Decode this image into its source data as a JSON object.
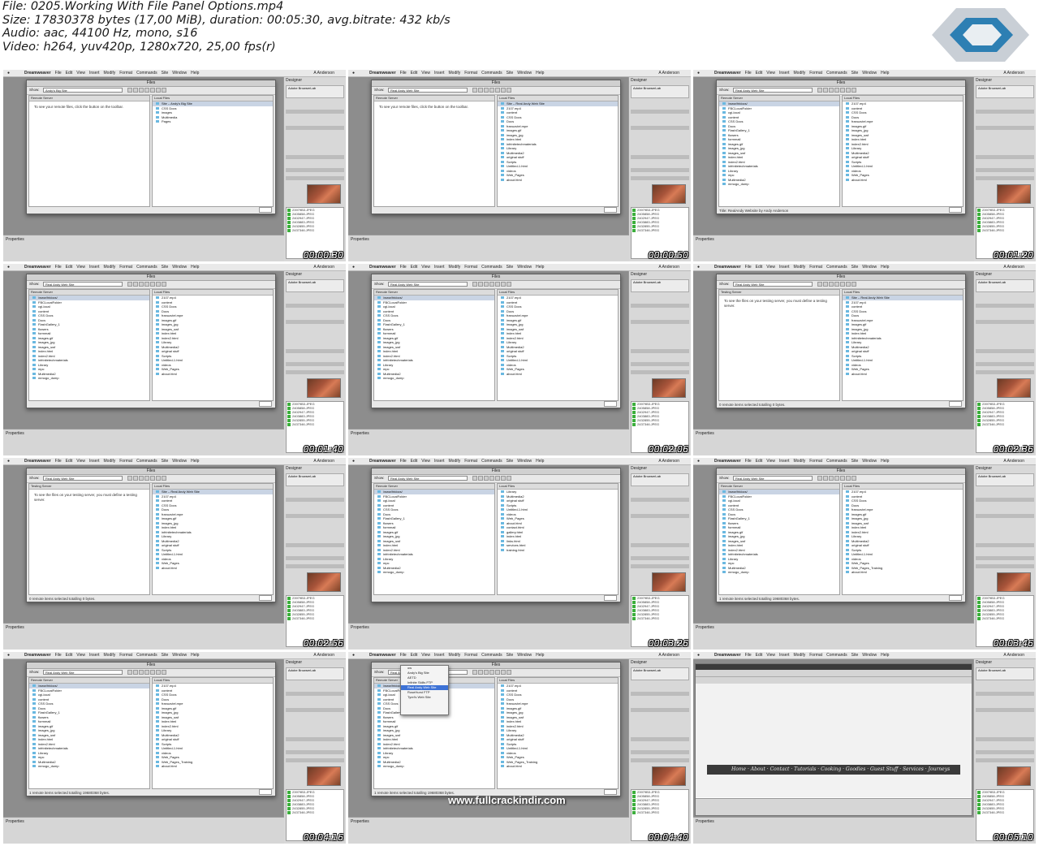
{
  "header": {
    "file_line": "File: 0205.Working With File Panel Options.mp4",
    "size_line": "Size: 17830378 bytes (17,00 MiB), duration: 00:05:30, avg.bitrate: 432 kb/s",
    "audio_line": "Audio: aac, 44100 Hz, mono, s16",
    "video_line": "Video: h264, yuv420p, 1280x720, 25,00 fps(r)"
  },
  "app": {
    "apple": "",
    "name": "Dreamweaver",
    "menus": [
      "File",
      "Edit",
      "View",
      "Insert",
      "Modify",
      "Format",
      "Commands",
      "Site",
      "Window",
      "Help"
    ],
    "user": "A Anderson",
    "workspace": "Designer",
    "files_panel_title": "Files",
    "show_label": "Show:",
    "properties_label": "Properties",
    "right_panel_title": "Adobe BrowserLab"
  },
  "assets": [
    "23979B3.JPEG",
    "2405858.JPEG",
    "2402947.JPEG",
    "2403883.JPEG",
    "2432855.JPEG",
    "2437346.JPEG"
  ],
  "timestamps": [
    "00:00:30",
    "00:00:50",
    "00:01:20",
    "00:01:40",
    "00:02:06",
    "00:02:36",
    "00:02:56",
    "00:03:26",
    "00:03:46",
    "00:04:16",
    "00:04:40",
    "00:05:10"
  ],
  "thumbnails": [
    {
      "site": "Andy's Big Site",
      "left_header": "Remote Server",
      "right_header": "Local Files",
      "left_note": "To see your remote files, click the button on the toolbar.",
      "left_rows": [],
      "right_rows": [
        "Site – Andy's Big Site",
        "CSS Docs",
        "images",
        "Multimedia",
        "Pages"
      ],
      "status": ""
    },
    {
      "site": "Real Andy Web Site",
      "left_header": "Remote Server",
      "right_header": "Local Files",
      "left_note": "To see your remote files, click the button on the toolbar.",
      "left_rows": [],
      "right_rows": [
        "Site – Real Andy Web Site",
        "2107.mp4",
        "content",
        "CSS Docs",
        "Docs",
        "franuzutel.mpe",
        "images.gif",
        "images_jpg",
        "index.html",
        "infrinitetechmaterials",
        "Library",
        "Multimedia2",
        "original stuff",
        "Scripts",
        "Untitled-1.html",
        "videos",
        "Web_Pages",
        "about.html"
      ],
      "status": ""
    },
    {
      "site": "Real Andy Web Site",
      "left_header": "Remote Server",
      "right_header": "Local Files",
      "left_note": "",
      "left_rows": [
        "/www/htdocs/",
        "FBCLocalFolder",
        "cgi-local",
        "content",
        "CSS Docs",
        "Docs",
        "FlashGallery_1",
        "flowers",
        "formmail",
        "images.gif",
        "images_jpg",
        "images_swf",
        "index.html",
        "index2.html",
        "infrinitetechmaterials",
        "Library",
        "mpc",
        "Multimedia2",
        "mmogo_dump"
      ],
      "right_rows": [
        "2107.mp4",
        "content",
        "CSS Docs",
        "Docs",
        "franuzutel.mpe",
        "images.gif",
        "images_jpg",
        "images_swf",
        "index.html",
        "index2.html",
        "Library",
        "Multimedia2",
        "original stuff",
        "Scripts",
        "Untitled-1.html",
        "videos",
        "Web_Pages",
        "about.html"
      ],
      "status": "Title: RealAndy Website by Andy Anderson"
    },
    {
      "site": "Real Andy Web Site",
      "left_header": "Remote Server",
      "right_header": "Local Files",
      "left_note": "",
      "left_rows": [
        "/www/htdocs/",
        "FBCLocalFolder",
        "cgi-local",
        "content",
        "CSS Docs",
        "Docs",
        "FlashGallery_1",
        "flowers",
        "formmail",
        "images.gif",
        "images_jpg",
        "images_swf",
        "index.html",
        "index2.html",
        "infrinitetechmaterials",
        "Library",
        "mpc",
        "Multimedia2",
        "mmogo_dump"
      ],
      "right_rows": [
        "2107.mp4",
        "content",
        "CSS Docs",
        "Docs",
        "franuzutel.mpe",
        "images.gif",
        "images_jpg",
        "images_swf",
        "index.html",
        "index2.html",
        "Library",
        "Multimedia2",
        "original stuff",
        "Scripts",
        "Untitled-1.html",
        "videos",
        "Web_Pages",
        "about.html"
      ],
      "status": ""
    },
    {
      "site": "Real Andy Web Site",
      "left_header": "Remote Server",
      "right_header": "Local Files",
      "left_note": "",
      "left_rows": [
        "/www/htdocs/",
        "FBCLocalFolder",
        "cgi-local",
        "content",
        "CSS Docs",
        "Docs",
        "FlashGallery_1",
        "flowers",
        "formmail",
        "images.gif",
        "images_jpg",
        "images_swf",
        "index.html",
        "index2.html",
        "infrinitetechmaterials",
        "Library",
        "mpc",
        "Multimedia2",
        "mmogo_dump"
      ],
      "right_rows": [
        "2107.mp4",
        "content",
        "CSS Docs",
        "Docs",
        "franuzutel.mpe",
        "images.gif",
        "images_jpg",
        "images_swf",
        "index.html",
        "index2.html",
        "Library",
        "Multimedia2",
        "original stuff",
        "Scripts",
        "Untitled-1.html",
        "videos",
        "Web_Pages",
        "about.html"
      ],
      "status": ""
    },
    {
      "site": "Real Andy Web Site",
      "left_header": "Testing Server",
      "right_header": "Local Files",
      "left_note": "To see the files on your testing server, you must define a testing server.",
      "left_rows": [],
      "right_rows": [
        "Site – Real Andy Web Site",
        "2107.mp4",
        "content",
        "CSS Docs",
        "Docs",
        "franuzutel.mpe",
        "images.gif",
        "images_jpg",
        "index.html",
        "infrinitetechmaterials",
        "Library",
        "Multimedia2",
        "original stuff",
        "Scripts",
        "Untitled-1.html",
        "videos",
        "Web_Pages",
        "about.html"
      ],
      "status": "0 remote items selected totalling 0 bytes."
    },
    {
      "site": "Real Andy Web Site",
      "left_header": "Testing Server",
      "right_header": "Local Files",
      "left_note": "To see the files on your testing server, you must define a testing server.",
      "left_rows": [],
      "right_rows": [
        "Site – Real Andy Web Site",
        "2107.mp4",
        "content",
        "CSS Docs",
        "Docs",
        "franuzutel.mpe",
        "images.gif",
        "images_jpg",
        "index.html",
        "infrinitetechmaterials",
        "Library",
        "Multimedia2",
        "original stuff",
        "Scripts",
        "Untitled-1.html",
        "videos",
        "Web_Pages",
        "about.html"
      ],
      "status": "0 remote items selected totalling 0 bytes."
    },
    {
      "site": "Real Andy Web Site",
      "left_header": "Remote Server",
      "right_header": "Local Files",
      "left_note": "",
      "left_rows": [
        "/www/htdocs/",
        "FBCLocalFolder",
        "cgi-local",
        "content",
        "CSS Docs",
        "Docs",
        "FlashGallery_1",
        "flowers",
        "formmail",
        "images.gif",
        "images_jpg",
        "images_swf",
        "index.html",
        "index2.html",
        "infrinitetechmaterials",
        "Library",
        "mpc",
        "Multimedia2",
        "mmogo_dump"
      ],
      "right_rows": [
        "Library",
        "Multimedia2",
        "original stuff",
        "Scripts",
        "Untitled-1.html",
        "videos",
        "Web_Pages",
        "about.html",
        "contact.html",
        "gallery.html",
        "index.html",
        "links.html",
        "services.html",
        "training.html"
      ],
      "status": ""
    },
    {
      "site": "Real Andy Web Site",
      "left_header": "Remote Server",
      "right_header": "Local Files",
      "left_note": "",
      "left_rows": [
        "/www/htdocs/",
        "FBCLocalFolder",
        "cgi-local",
        "content",
        "CSS Docs",
        "Docs",
        "FlashGallery_1",
        "flowers",
        "formmail",
        "images.gif",
        "images_jpg",
        "images_swf",
        "index.html",
        "index2.html",
        "infrinitetechmaterials",
        "Library",
        "mpc",
        "Multimedia2",
        "mmogo_dump"
      ],
      "right_rows": [
        "2107.mp4",
        "content",
        "CSS Docs",
        "Docs",
        "franuzutel.mpe",
        "images.gif",
        "images_jpg",
        "images_swf",
        "index.html",
        "index2.html",
        "Library",
        "Multimedia2",
        "original stuff",
        "Scripts",
        "Untitled-1.html",
        "videos",
        "Web_Pages",
        "Web_Pages_Training",
        "about.html"
      ],
      "status": "1 remote items selected totalling 19680368 bytes."
    },
    {
      "site": "Real Andy Web Site",
      "left_header": "Remote Server",
      "right_header": "Local Files",
      "left_note": "",
      "left_rows": [
        "/www/htdocs/",
        "FBCLocalFolder",
        "cgi-local",
        "content",
        "CSS Docs",
        "Docs",
        "FlashGallery_1",
        "flowers",
        "formmail",
        "images.gif",
        "images_jpg",
        "images_swf",
        "index.html",
        "index2.html",
        "infrinitetechmaterials",
        "Library",
        "mpc",
        "Multimedia2",
        "mmogo_dump"
      ],
      "right_rows": [
        "2107.mp4",
        "content",
        "CSS Docs",
        "Docs",
        "franuzutel.mpe",
        "images.gif",
        "images_jpg",
        "images_swf",
        "index.html",
        "index2.html",
        "Library",
        "Multimedia2",
        "original stuff",
        "Scripts",
        "Untitled-1.html",
        "videos",
        "Web_Pages",
        "Web_Pages_Training",
        "about.html"
      ],
      "status": "1 remote items selected totalling 19680368 bytes."
    }
  ],
  "popup": {
    "items": [
      "ow",
      "Andy's Big Site",
      "AETD",
      "Infinite Skills FTP",
      "Real Andy Web Site",
      "RoseHurst FTP",
      "Tyrel's Web Site"
    ]
  },
  "watermark": "www.fullcrackindir.com",
  "design_view": {
    "nav_text": "Home · About · Contact · Tutorials · Cooking · Goodies · Guest Stuff · Services · Journeys"
  }
}
